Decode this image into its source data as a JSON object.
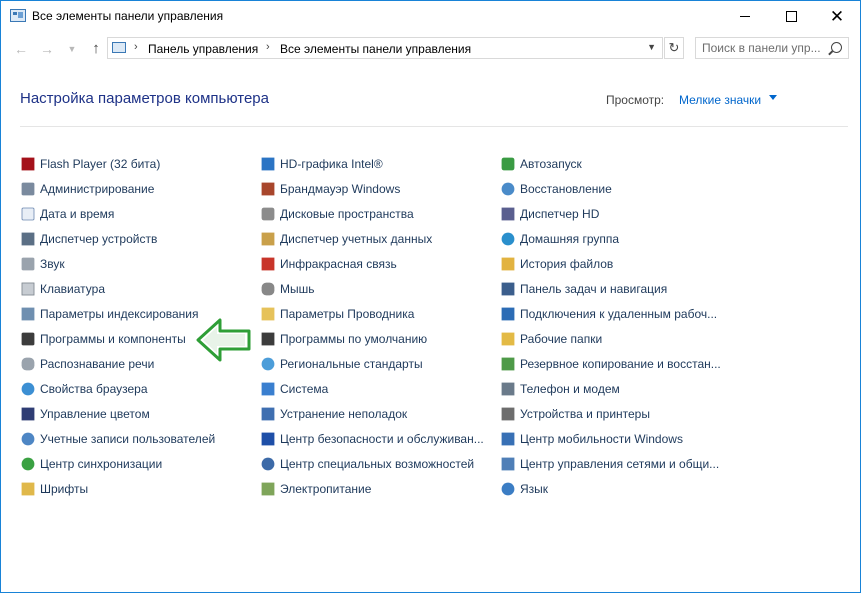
{
  "window": {
    "title": "Все элементы панели управления",
    "minimize": "minimize",
    "maximize": "maximize",
    "close": "✕"
  },
  "nav": {
    "breadcrumbs": [
      "Панель управления",
      "Все элементы панели управления"
    ],
    "search_placeholder": "Поиск в панели упр..."
  },
  "header": {
    "title": "Настройка параметров компьютера",
    "view_label": "Просмотр:",
    "view_value": "Мелкие значки"
  },
  "columns": [
    [
      {
        "label": "Flash Player (32 бита)",
        "icon": "flash-icon"
      },
      {
        "label": "Администрирование",
        "icon": "admin-tools-icon"
      },
      {
        "label": "Дата и время",
        "icon": "clock-icon"
      },
      {
        "label": "Диспетчер устройств",
        "icon": "device-manager-icon"
      },
      {
        "label": "Звук",
        "icon": "speaker-icon"
      },
      {
        "label": "Клавиатура",
        "icon": "keyboard-icon"
      },
      {
        "label": "Параметры индексирования",
        "icon": "indexing-icon"
      },
      {
        "label": "Программы и компоненты",
        "icon": "programs-icon"
      },
      {
        "label": "Распознавание речи",
        "icon": "microphone-icon"
      },
      {
        "label": "Свойства браузера",
        "icon": "globe-icon"
      },
      {
        "label": "Управление цветом",
        "icon": "color-monitor-icon"
      },
      {
        "label": "Учетные записи пользователей",
        "icon": "users-icon"
      },
      {
        "label": "Центр синхронизации",
        "icon": "sync-icon"
      },
      {
        "label": "Шрифты",
        "icon": "fonts-icon"
      }
    ],
    [
      {
        "label": "HD-графика Intel®",
        "icon": "intel-graphics-icon"
      },
      {
        "label": "Брандмауэр Windows",
        "icon": "firewall-icon"
      },
      {
        "label": "Дисковые пространства",
        "icon": "storage-spaces-icon"
      },
      {
        "label": "Диспетчер учетных данных",
        "icon": "credential-manager-icon"
      },
      {
        "label": "Инфракрасная связь",
        "icon": "infrared-icon"
      },
      {
        "label": "Мышь",
        "icon": "mouse-icon"
      },
      {
        "label": "Параметры Проводника",
        "icon": "folder-options-icon"
      },
      {
        "label": "Программы по умолчанию",
        "icon": "default-programs-icon"
      },
      {
        "label": "Региональные стандарты",
        "icon": "region-icon"
      },
      {
        "label": "Система",
        "icon": "system-icon"
      },
      {
        "label": "Устранение неполадок",
        "icon": "troubleshooting-icon"
      },
      {
        "label": "Центр безопасности и обслуживан...",
        "icon": "flag-icon"
      },
      {
        "label": "Центр специальных возможностей",
        "icon": "accessibility-icon"
      },
      {
        "label": "Электропитание",
        "icon": "power-icon"
      }
    ],
    [
      {
        "label": "Автозапуск",
        "icon": "autoplay-icon"
      },
      {
        "label": "Восстановление",
        "icon": "recovery-icon"
      },
      {
        "label": "Диспетчер HD",
        "icon": "hd-audio-icon"
      },
      {
        "label": "Домашняя группа",
        "icon": "homegroup-icon"
      },
      {
        "label": "История файлов",
        "icon": "file-history-icon"
      },
      {
        "label": "Панель задач и навигация",
        "icon": "taskbar-icon"
      },
      {
        "label": "Подключения к удаленным рабоч...",
        "icon": "remote-desktop-icon"
      },
      {
        "label": "Рабочие папки",
        "icon": "work-folders-icon"
      },
      {
        "label": "Резервное копирование и восстан...",
        "icon": "backup-icon"
      },
      {
        "label": "Телефон и модем",
        "icon": "phone-modem-icon"
      },
      {
        "label": "Устройства и принтеры",
        "icon": "printer-icon"
      },
      {
        "label": "Центр мобильности Windows",
        "icon": "mobility-icon"
      },
      {
        "label": "Центр управления сетями и общи...",
        "icon": "network-icon"
      },
      {
        "label": "Язык",
        "icon": "language-icon"
      }
    ]
  ],
  "colors": {
    "link": "#1e395b",
    "title": "#1e3287",
    "accent": "#0066cc",
    "arrow": "#2e9e36"
  }
}
